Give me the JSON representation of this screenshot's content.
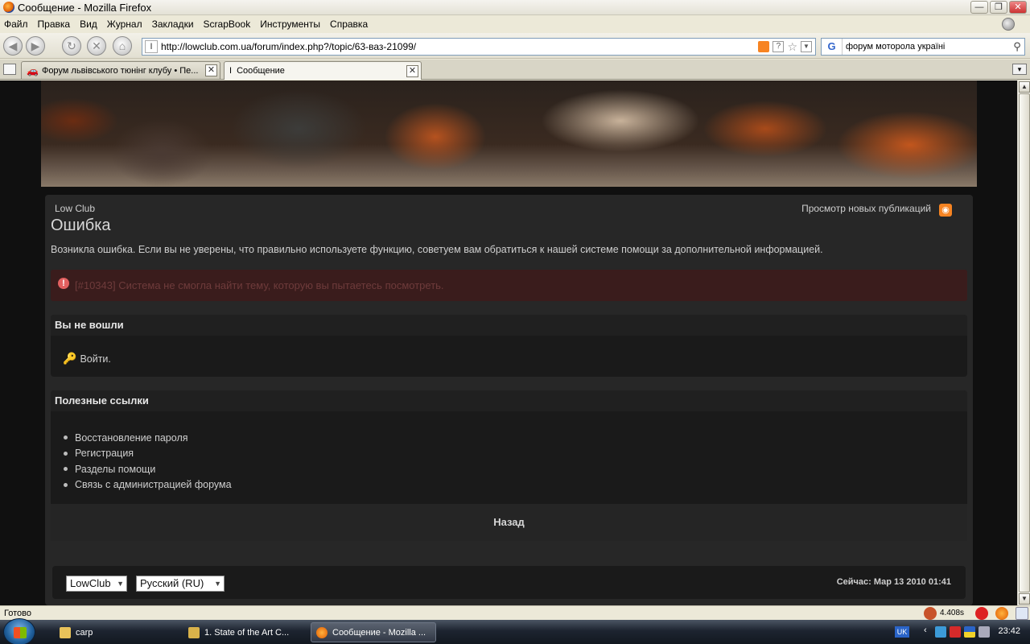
{
  "window": {
    "title": "Сообщение - Mozilla Firefox",
    "buttons": [
      "—",
      "❐",
      "✕"
    ]
  },
  "menu": [
    "Файл",
    "Правка",
    "Вид",
    "Журнал",
    "Закладки",
    "ScrapBook",
    "Инструменты",
    "Справка"
  ],
  "nav": {
    "url": "http://lowclub.com.ua/forum/index.php?/topic/63-ваз-21099/",
    "search_engine": "G",
    "search_value": "форум моторола україні"
  },
  "tabs": [
    {
      "label": "Форум львівського тюнінг клубу • Пе...",
      "active": false
    },
    {
      "label": "Сообщение",
      "active": true
    }
  ],
  "page": {
    "breadcrumb": "Low Club",
    "title": "Ошибка",
    "new_posts_link": "Просмотр новых публикаций",
    "intro": "Возникла ошибка. Если вы не уверены, что правильно используете функцию, советуем вам обратиться к нашей системе помощи за дополнительной информацией.",
    "error": "[#10343] Система не смогла найти тему, которую вы пытаетесь посмотреть.",
    "login_panel": {
      "heading": "Вы не вошли",
      "login_link": "Войти."
    },
    "links_panel": {
      "heading": "Полезные ссылки",
      "items": [
        "Восстановление пароля",
        "Регистрация",
        "Разделы помощи",
        "Связь с администрацией форума"
      ]
    },
    "back": "Назад",
    "footer": {
      "skin_select": "LowClub",
      "lang_select": "Русский (RU)",
      "time": "Сейчас: Мар 13 2010 01:41"
    }
  },
  "status": {
    "text": "Готово",
    "timing": "4.408s"
  },
  "taskbar": {
    "tasks": [
      {
        "label": "carp",
        "active": false
      },
      {
        "label": "1. State of the Art C...",
        "active": false
      },
      {
        "label": "Сообщение - Mozilla ...",
        "active": true
      }
    ],
    "tray_lang": "UK",
    "clock": "23:42"
  },
  "colors": {
    "page_bg": "#101010",
    "panel_bg": "#272727",
    "error_bg": "#3a1c1c",
    "error_text": "#6e3b3b",
    "rss": "#f78422"
  }
}
